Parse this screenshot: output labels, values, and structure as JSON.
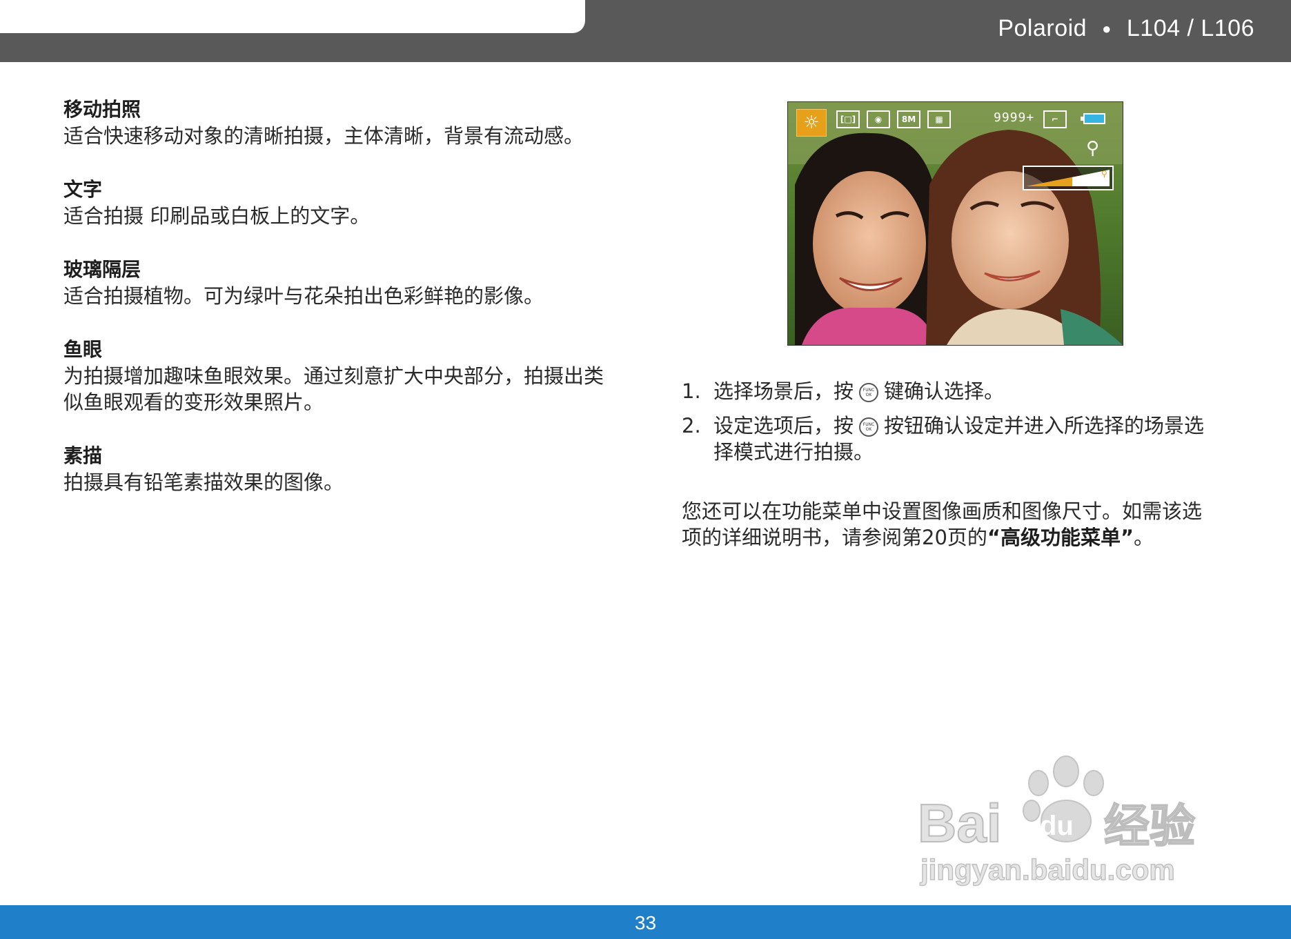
{
  "header": {
    "brand": "Polaroid",
    "separator": "●",
    "model": "L104 / L106"
  },
  "modes": [
    {
      "title": "移动拍照",
      "desc": "适合快速移动对象的清晰拍摄，主体清晰，背景有流动感。"
    },
    {
      "title": "文字",
      "desc": "适合拍摄 印刷品或白板上的文字。"
    },
    {
      "title": "玻璃隔层",
      "desc": "适合拍摄植物。可为绿叶与花朵拍出色彩鲜艳的影像。"
    },
    {
      "title": "鱼眼",
      "desc": "为拍摄增加趣味鱼眼效果。通过刻意扩大中央部分，拍摄出类似鱼眼观看的变形效果照片。"
    },
    {
      "title": "素描",
      "desc": "拍摄具有铅笔素描效果的图像。"
    }
  ],
  "camera_screen": {
    "shots_remaining": "9999+",
    "resolution_badge": "8M",
    "icons": [
      "scene-mode-icon",
      "focus-area-icon",
      "metering-icon",
      "resolution-icon",
      "quality-icon",
      "sd-card-icon",
      "battery-icon",
      "zoom-icon"
    ],
    "zoom_level": 0.55,
    "accent_color": "#e6a019"
  },
  "steps": [
    {
      "num": "1.",
      "before": "选择场景后，按",
      "after": "键确认选择。"
    },
    {
      "num": "2.",
      "before": "设定选项后，按",
      "after": "按钮确认设定并进入所选择的场景选择模式进行拍摄。"
    }
  ],
  "func_button": {
    "top": "FUNC",
    "bottom": "OK"
  },
  "note": {
    "text_before": "您还可以在功能菜单中设置图像画质和图像尺寸。如需该选项的详细说明书，请参阅第20页的",
    "quote_open": "“",
    "bold": "高级功能菜单",
    "quote_close": "”",
    "text_after": "。"
  },
  "watermark": {
    "logo": "Bai du 经验",
    "url": "jingyan.baidu.com"
  },
  "footer": {
    "page_number": "33"
  },
  "colors": {
    "header_gray": "#595959",
    "footer_blue": "#1f7fc9"
  }
}
